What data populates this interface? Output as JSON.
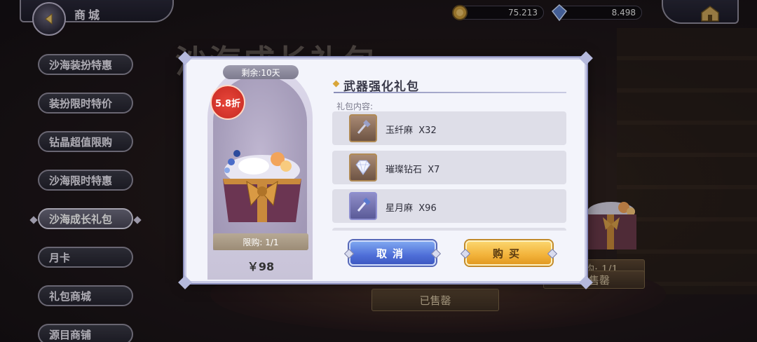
{
  "topbar": {
    "title": "商城",
    "currency_gold": "75.213",
    "currency_crystal": "8.498"
  },
  "sidebar": {
    "items": [
      {
        "label": "沙海装扮特惠",
        "active": false
      },
      {
        "label": "装扮限时特价",
        "active": false
      },
      {
        "label": "钻晶超值限购",
        "active": false
      },
      {
        "label": "沙海限时特惠",
        "active": false
      },
      {
        "label": "沙海成长礼包",
        "active": true
      },
      {
        "label": "月卡",
        "active": false
      },
      {
        "label": "礼包商城",
        "active": false
      },
      {
        "label": "源目商铺",
        "active": false
      }
    ]
  },
  "background": {
    "page_title": "沙海成长礼包",
    "sold_out_label": "已售罄",
    "limit_label": "限购: 1/1"
  },
  "dialog": {
    "remaining": "剩余:10天",
    "discount": "5.8折",
    "pack_title": "武器强化礼包",
    "contents_label": "礼包内容:",
    "items": [
      {
        "name": "玉纤麻",
        "qty": "X32",
        "icon": "hammer-icon"
      },
      {
        "name": "璀璨钻石",
        "qty": "X7",
        "icon": "diamond-icon"
      },
      {
        "name": "星月麻",
        "qty": "X96",
        "icon": "hammer-icon"
      }
    ],
    "limit": "限购: 1/1",
    "price": "￥98",
    "cancel_label": "取消",
    "buy_label": "购买"
  },
  "colors": {
    "accent_gold": "#f2b23a",
    "accent_blue": "#4f6fd8",
    "discount_red": "#e8463a"
  }
}
